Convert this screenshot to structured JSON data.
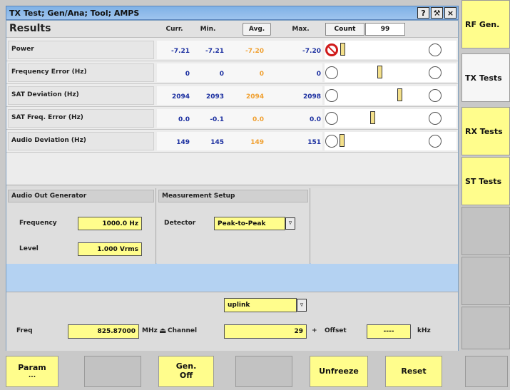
{
  "window": {
    "title": "TX Test; Gen/Ana; Tool; AMPS",
    "help_glyph": "?",
    "tool_glyph": "⚒",
    "close_glyph": "×"
  },
  "results": {
    "title": "Results",
    "columns": {
      "curr": "Curr.",
      "min": "Min.",
      "avg": "Avg.",
      "max": "Max."
    },
    "count_label": "Count",
    "count_value": "99",
    "rows": [
      {
        "label": "Power",
        "curr": "-7.21",
        "min": "-7.21",
        "avg": "-7.20",
        "max": "-7.20"
      },
      {
        "label": "Frequency Error (Hz)",
        "curr": "0",
        "min": "0",
        "avg": "0",
        "max": "0"
      },
      {
        "label": "SAT Deviation (Hz)",
        "curr": "2094",
        "min": "2093",
        "avg": "2094",
        "max": "2098"
      },
      {
        "label": "SAT Freq. Error (Hz)",
        "curr": "0.0",
        "min": "-0.1",
        "avg": "0.0",
        "max": "0.0"
      },
      {
        "label": "Audio Deviation (Hz)",
        "curr": "149",
        "min": "145",
        "avg": "149",
        "max": "151"
      }
    ]
  },
  "audio_gen": {
    "title": "Audio Out Generator",
    "freq_label": "Frequency",
    "freq_value": "1000.0 Hz",
    "level_label": "Level",
    "level_value": "1.000 Vrms"
  },
  "meas_setup": {
    "title": "Measurement Setup",
    "detector_label": "Detector",
    "detector_value": "Peak-to-Peak"
  },
  "freq_panel": {
    "freq_label": "Freq",
    "freq_value": "825.87000",
    "freq_unit": "MHz",
    "channel_label": "Channel",
    "link_value": "uplink",
    "channel_value": "29",
    "plus": "+",
    "offset_label": "Offset",
    "offset_value": "----",
    "offset_unit": "kHz"
  },
  "side_buttons": [
    "RF Gen.",
    "TX Tests",
    "RX Tests",
    "ST Tests",
    "",
    "",
    ""
  ],
  "soft_keys": {
    "param": "Param",
    "param_sub": "...",
    "gen": "Gen.",
    "gen_sub": "Off",
    "unfreeze": "Unfreeze",
    "reset": "Reset"
  },
  "colors": {
    "accent_yellow": "#fffd8c",
    "title_blue": "#9ec4ee",
    "value_blue": "#1b2fa0",
    "avg_orange": "#f0a030",
    "alarm_red": "#d01a1a"
  }
}
